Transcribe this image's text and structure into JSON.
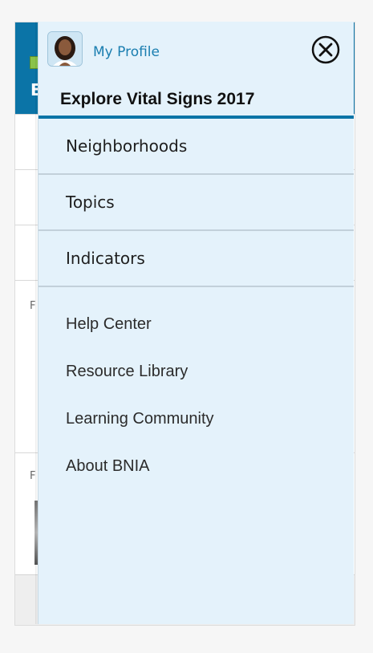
{
  "profile": {
    "link_label": "My Profile",
    "avatar_icon": "person-avatar-icon"
  },
  "drawer": {
    "title": "Explore Vital Signs 2017",
    "close_icon": "close-circle-icon",
    "accent_color": "#0b74a7",
    "background_color": "#e4f2fb"
  },
  "nav_items": [
    {
      "label": "Neighborhoods"
    },
    {
      "label": "Topics"
    },
    {
      "label": "Indicators"
    }
  ],
  "links": [
    {
      "label": "Help Center"
    },
    {
      "label": "Resource Library"
    },
    {
      "label": "Learning Community"
    },
    {
      "label": "About BNIA"
    }
  ],
  "background_app": {
    "title_letter": "E",
    "section_label_1": "F",
    "section_label_2": "F"
  }
}
